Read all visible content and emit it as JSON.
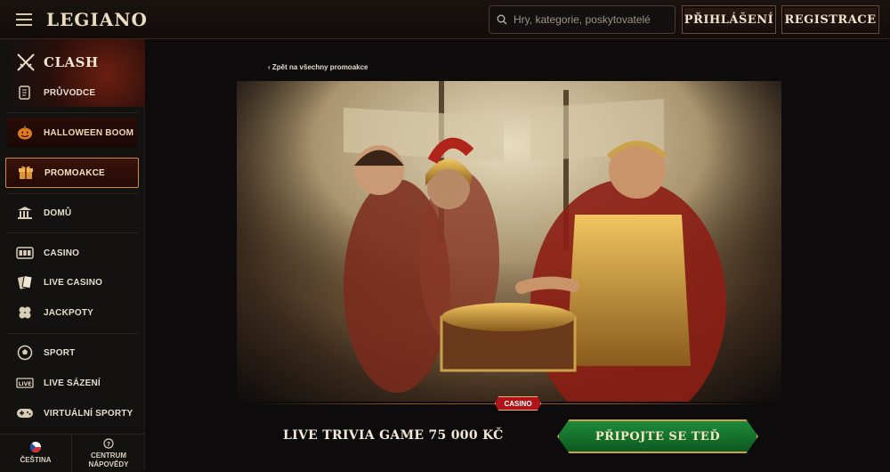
{
  "header": {
    "logo_text": "LEGIANO",
    "search_placeholder": "Hry, kategorie, poskytovatelé",
    "login_label": "PŘIHLÁŠENÍ",
    "register_label": "REGISTRACE"
  },
  "sidebar": {
    "clash_title": "CLASH",
    "items": [
      {
        "label": "PRŮVODCE",
        "icon": "scroll-icon"
      },
      {
        "label": "HALLOWEEN BOOM",
        "icon": "pumpkin-icon"
      },
      {
        "label": "PROMOAKCE",
        "icon": "gift-icon"
      },
      {
        "label": "DOMŮ",
        "icon": "temple-icon"
      },
      {
        "label": "CASINO",
        "icon": "slot-machine-icon"
      },
      {
        "label": "LIVE CASINO",
        "icon": "cards-icon"
      },
      {
        "label": "JACKPOTY",
        "icon": "clover-icon"
      },
      {
        "label": "SPORT",
        "icon": "ball-icon"
      },
      {
        "label": "LIVE SÁZENÍ",
        "icon": "live-icon"
      },
      {
        "label": "VIRTUÁLNÍ SPORTY",
        "icon": "gamepad-icon"
      }
    ],
    "language_label": "ČEŠTINA",
    "help_label_1": "CENTRUM",
    "help_label_2": "NÁPOVĚDY"
  },
  "main": {
    "back_link": "Zpět na všechny promoakce",
    "category_badge": "CASINO",
    "promo_title": "LIVE TRIVIA GAME 75 000 KČ",
    "cta_label": "PŘIPOJTE SE TEĎ"
  },
  "colors": {
    "accent_gold": "#c9a24a",
    "cta_green": "#1e8a3a",
    "badge_red": "#b0141a"
  }
}
